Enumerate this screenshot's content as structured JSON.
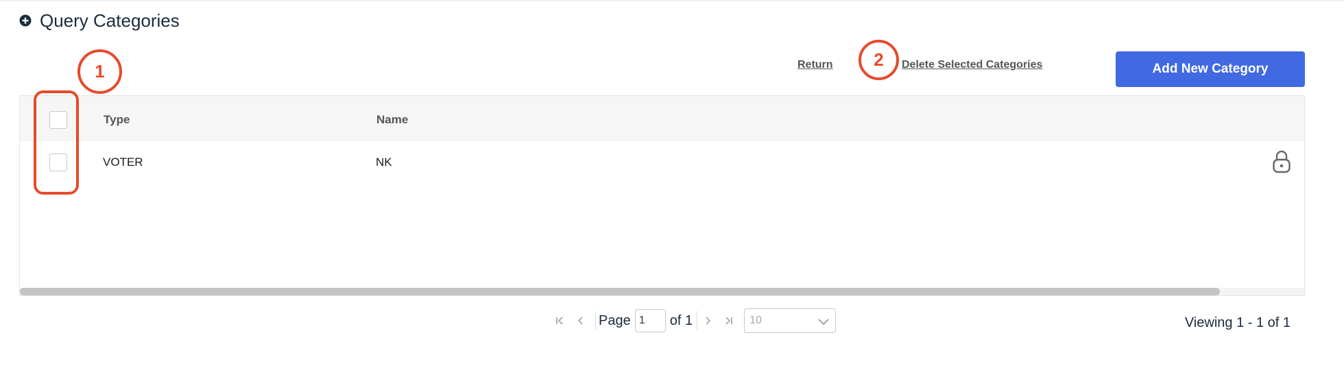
{
  "section": {
    "title": "Query Categories",
    "expand_icon": "plus-circle-icon"
  },
  "actions": {
    "return_label": "Return",
    "delete_label": "Delete Selected Categories",
    "add_label": "Add New Category",
    "add_color": "#4169E1"
  },
  "grid": {
    "columns": [
      "Type",
      "Name"
    ],
    "rows": [
      {
        "type": "VOTER",
        "name": "NK",
        "status_icon": "lock-icon"
      }
    ]
  },
  "pager": {
    "page_label": "Page",
    "current_page": "1",
    "of_label": "of 1",
    "page_size": "10",
    "viewing_text": "Viewing 1 - 1 of 1"
  },
  "annotations": {
    "marker_1": "1",
    "marker_2": "2",
    "color": "#E54B2B"
  }
}
